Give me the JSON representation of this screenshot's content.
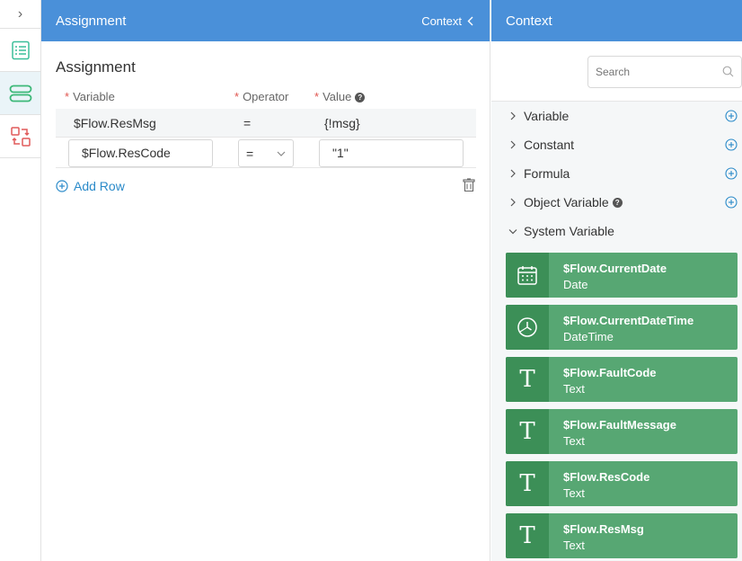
{
  "rail": {
    "toggle_glyph": "›"
  },
  "panel": {
    "header_title": "Assignment",
    "context_label": "Context",
    "section_title": "Assignment",
    "columns": {
      "variable": "Variable",
      "operator": "Operator",
      "value": "Value"
    },
    "required_mark": "*",
    "rows": [
      {
        "variable": "$Flow.ResMsg",
        "operator": "=",
        "value": "{!msg}"
      },
      {
        "variable": "$Flow.ResCode",
        "operator": "=",
        "value": "\"1\""
      }
    ],
    "add_row_label": "Add Row"
  },
  "context": {
    "header_title": "Context",
    "search_placeholder": "Search",
    "categories": [
      {
        "label": "Variable",
        "expanded": false
      },
      {
        "label": "Constant",
        "expanded": false
      },
      {
        "label": "Formula",
        "expanded": false
      },
      {
        "label": "Object Variable",
        "expanded": false
      },
      {
        "label": "System Variable",
        "expanded": true
      }
    ],
    "system_variables": [
      {
        "name": "$Flow.CurrentDate",
        "type": "Date",
        "icon": "calendar-icon"
      },
      {
        "name": "$Flow.CurrentDateTime",
        "type": "DateTime",
        "icon": "clock-icon"
      },
      {
        "name": "$Flow.FaultCode",
        "type": "Text",
        "icon": "text-icon"
      },
      {
        "name": "$Flow.FaultMessage",
        "type": "Text",
        "icon": "text-icon"
      },
      {
        "name": "$Flow.ResCode",
        "type": "Text",
        "icon": "text-icon"
      },
      {
        "name": "$Flow.ResMsg",
        "type": "Text",
        "icon": "text-icon"
      }
    ]
  },
  "colors": {
    "header_blue": "#4a90d9",
    "link_blue": "#2a8ac9",
    "sysvar_green": "#57a773",
    "sysvar_icon_green": "#3c8f57",
    "required_red": "#e0554f"
  },
  "help_glyph": "?",
  "text_glyph": "T"
}
